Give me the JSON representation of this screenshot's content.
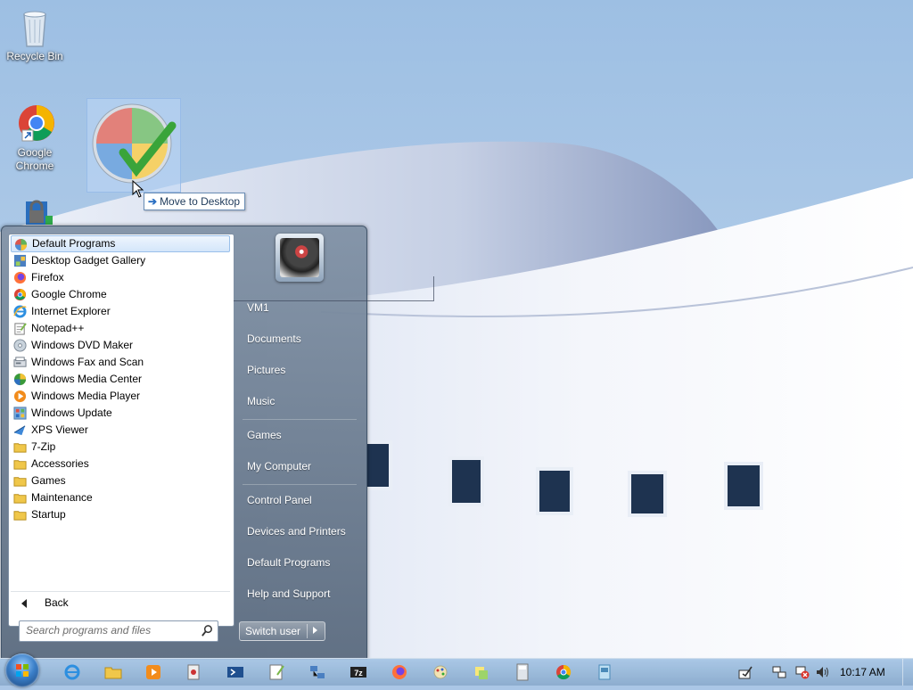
{
  "desktop": {
    "icons": [
      {
        "label": "Recycle Bin",
        "icon": "recycle-bin-icon"
      },
      {
        "label": "Google Chrome",
        "icon": "chrome-icon"
      },
      {
        "label": "",
        "icon": "lock-shortcut-icon"
      }
    ],
    "drag_tooltip": "Move to Desktop",
    "dragged_icon": "default-programs-icon"
  },
  "start_menu": {
    "programs": [
      {
        "label": "Default Programs",
        "icon": "default-programs-icon",
        "selected": true
      },
      {
        "label": "Desktop Gadget Gallery",
        "icon": "gadget-gallery-icon"
      },
      {
        "label": "Firefox",
        "icon": "firefox-icon"
      },
      {
        "label": "Google Chrome",
        "icon": "chrome-icon"
      },
      {
        "label": "Internet Explorer",
        "icon": "ie-icon"
      },
      {
        "label": "Notepad++",
        "icon": "notepadpp-icon"
      },
      {
        "label": "Windows DVD Maker",
        "icon": "dvd-maker-icon"
      },
      {
        "label": "Windows Fax and Scan",
        "icon": "fax-scan-icon"
      },
      {
        "label": "Windows Media Center",
        "icon": "media-center-icon"
      },
      {
        "label": "Windows Media Player",
        "icon": "media-player-icon"
      },
      {
        "label": "Windows Update",
        "icon": "windows-update-icon"
      },
      {
        "label": "XPS Viewer",
        "icon": "xps-viewer-icon"
      },
      {
        "label": "7-Zip",
        "icon": "folder-icon"
      },
      {
        "label": "Accessories",
        "icon": "folder-icon"
      },
      {
        "label": "Games",
        "icon": "folder-icon"
      },
      {
        "label": "Maintenance",
        "icon": "folder-icon"
      },
      {
        "label": "Startup",
        "icon": "folder-icon"
      }
    ],
    "back_label": "Back",
    "search_placeholder": "Search programs and files",
    "right_links": [
      "VM1",
      "Documents",
      "Pictures",
      "Music",
      "Games",
      "My Computer",
      "Control Panel",
      "Devices and Printers",
      "Default Programs",
      "Help and Support"
    ],
    "switch_user_label": "Switch user"
  },
  "taskbar": {
    "pinned": [
      "ie-icon",
      "explorer-icon",
      "media-player-icon",
      "app-icon",
      "powershell-icon",
      "notepad-icon",
      "network-app-icon",
      "7zip-icon",
      "firefox-icon",
      "paint-icon",
      "sticky-icon",
      "calculator-icon",
      "chrome-icon",
      "remote-icon"
    ],
    "clock": "10:17 AM",
    "tray_icons": [
      "action-center-icon",
      "network-icon",
      "network-error-icon",
      "volume-icon"
    ]
  },
  "colors": {
    "sky": "#a9c6e6",
    "accent": "#2b6fc2",
    "start_menu_bg": "#7d8ea3"
  }
}
